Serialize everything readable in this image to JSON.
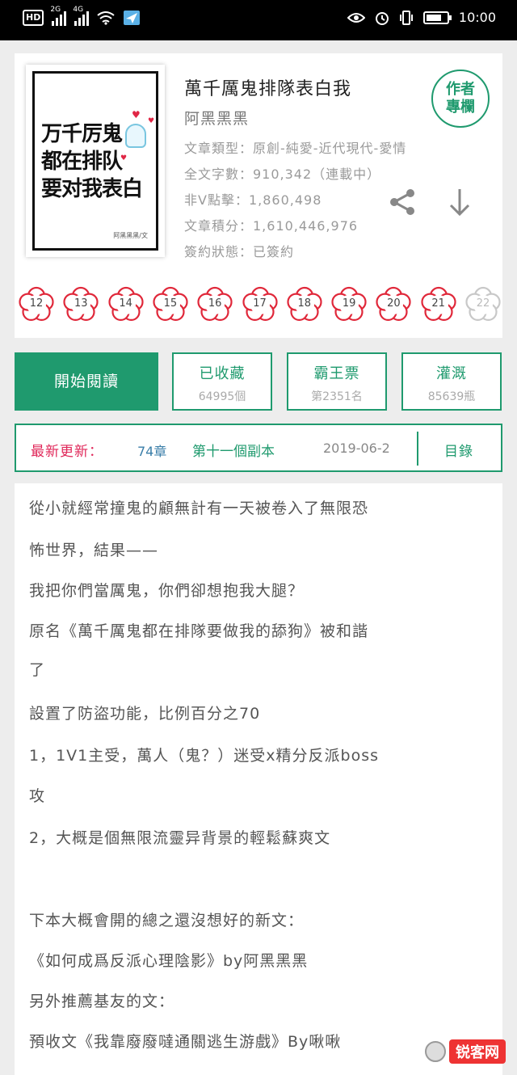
{
  "status_bar": {
    "hd": "HD",
    "net1": "2G",
    "net2": "4G",
    "time": "10:00"
  },
  "book": {
    "cover_title": [
      "万千厉鬼",
      "都在排队",
      "要对我表白"
    ],
    "cover_author": "阿黑黑黑/文",
    "title": "萬千厲鬼排隊表白我",
    "author": "阿黑黑黑",
    "meta": [
      "文章類型：原創-純愛-近代現代-愛情",
      "全文字數：910,342（連載中）",
      "非V點擊：1,860,498",
      "文章積分：1,610,446,976",
      "簽約狀態：已簽約"
    ],
    "author_badge": [
      "作者",
      "專欄"
    ]
  },
  "flowers": [
    "12",
    "13",
    "14",
    "15",
    "16",
    "17",
    "18",
    "19",
    "20",
    "21",
    "22"
  ],
  "actions": {
    "read": "開始閱讀",
    "collect": {
      "label": "已收藏",
      "count": "64995個"
    },
    "vote": {
      "label": "霸王票",
      "count": "第2351名"
    },
    "water": {
      "label": "灌溉",
      "count": "85639瓶"
    }
  },
  "update": {
    "label": "最新更新：",
    "chapter": "74章",
    "chapter_name": "第十一個副本",
    "date": "2019-06-2",
    "toc": "目錄"
  },
  "synopsis": [
    "從小就經常撞鬼的顧無計有一天被卷入了無限恐",
    "怖世界，結果——",
    "我把你們當厲鬼，你們卻想抱我大腿？",
    "原名《萬千厲鬼都在排隊要做我的舔狗》被和諧",
    "了",
    "設置了防盜功能，比例百分之70",
    "1，1V1主受，萬人（鬼？）迷受x精分反派boss",
    "攻",
    "2，大概是個無限流靈异背景的輕鬆蘇爽文",
    "",
    "下本大概會開的總之還沒想好的新文：",
    "《如何成爲反派心理陰影》by阿黑黑黑",
    "另外推薦基友的文：",
    "預收文《我靠廢廢噠通關逃生游戲》By啾啾"
  ],
  "watermark": "锐客网"
}
